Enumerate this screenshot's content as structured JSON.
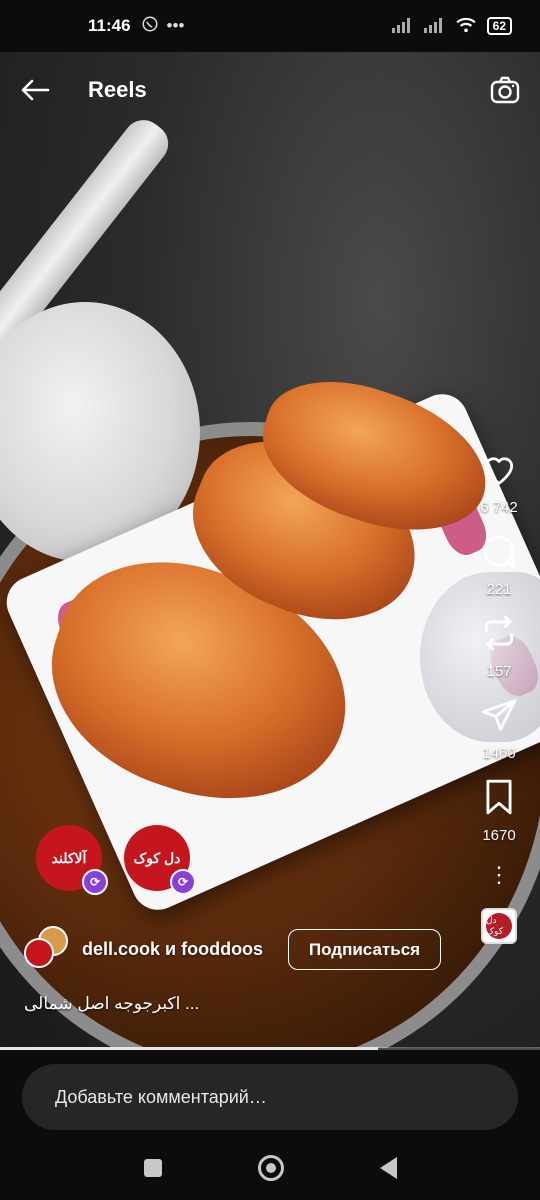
{
  "status_bar": {
    "time": "11:46",
    "left_icons": [
      "whatsapp-icon",
      "more-dots-icon"
    ],
    "right_icons": [
      "signal-icon",
      "signal-icon",
      "wifi-icon"
    ],
    "battery": "62"
  },
  "header": {
    "title": "Reels",
    "back_icon": "back-arrow-icon",
    "camera_icon": "camera-icon"
  },
  "actions": {
    "likes": "6 742",
    "comments": "221",
    "reposts": "157",
    "shares": "1460",
    "saves": "1670"
  },
  "collaborators": {
    "avatar1_text": "آلاکلند",
    "avatar2_text": "دل کوک"
  },
  "author": {
    "name": "dell.cook и fooddoos",
    "follow_label": "Подписаться"
  },
  "caption": "اکبرجوجه اصل شمالی ...",
  "audio_thumb_text": "دل کوک",
  "progress": {
    "fraction": 0.7
  },
  "comment": {
    "placeholder": "Добавьте комментарий…"
  },
  "colors": {
    "brand_red": "#c4161c",
    "collab_badge": "#8b3fd9"
  }
}
